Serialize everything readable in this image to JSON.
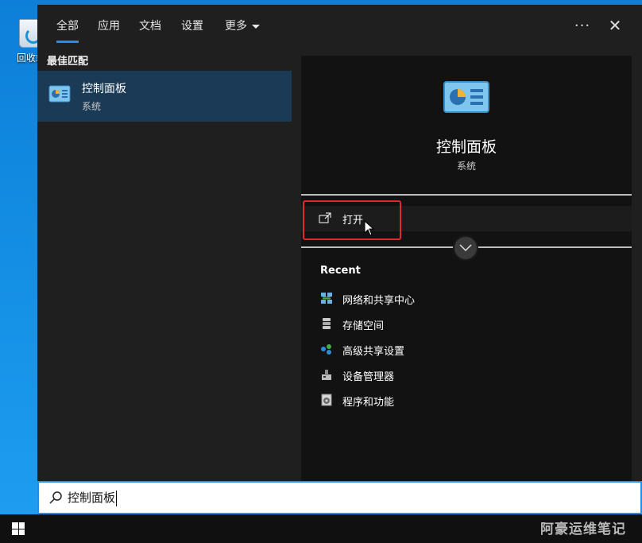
{
  "desktop": {
    "recycle_bin_label": "回收站"
  },
  "search_panel": {
    "tabs": [
      {
        "label": "全部",
        "active": true
      },
      {
        "label": "应用"
      },
      {
        "label": "文档"
      },
      {
        "label": "设置"
      },
      {
        "label": "更多"
      }
    ],
    "more_options_icon": "ellipsis-icon",
    "close_icon": "close-icon",
    "best_match_heading": "最佳匹配",
    "best_match": {
      "title": "控制面板",
      "subtitle": "系统",
      "icon": "control-panel-icon"
    },
    "preview": {
      "title": "控制面板",
      "subtitle": "系统",
      "open_label": "打开",
      "recent_heading": "Recent",
      "recent_items": [
        {
          "label": "网络和共享中心",
          "icon": "network-icon"
        },
        {
          "label": "存储空间",
          "icon": "storage-icon"
        },
        {
          "label": "高级共享设置",
          "icon": "sharing-icon"
        },
        {
          "label": "设备管理器",
          "icon": "device-manager-icon"
        },
        {
          "label": "程序和功能",
          "icon": "programs-icon"
        }
      ]
    },
    "search": {
      "value": "控制面板"
    }
  },
  "taskbar": {
    "watermark": "阿豪运维笔记"
  },
  "colors": {
    "accent": "#2b8ce6",
    "highlight_box": "#e0282e",
    "selected_bg": "#1b3a55"
  }
}
